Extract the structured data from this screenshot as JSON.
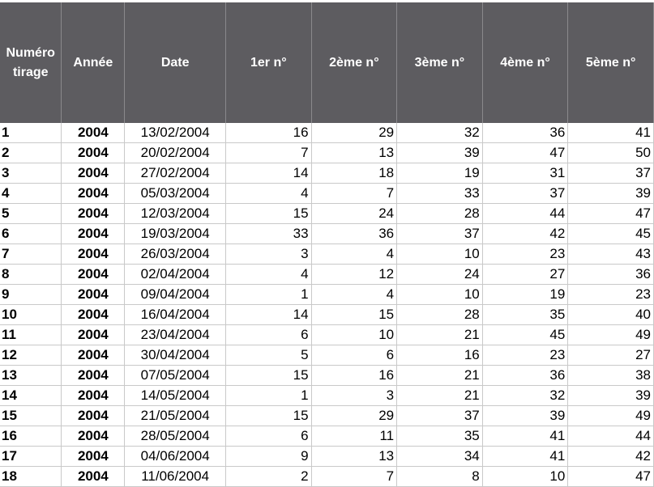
{
  "columns": [
    "Numéro tirage",
    "Année",
    "Date",
    "1er n°",
    "2ème n°",
    "3ème n°",
    "4ème n°",
    "5ème n°"
  ],
  "rows": [
    [
      "1",
      "2004",
      "13/02/2004",
      "16",
      "29",
      "32",
      "36",
      "41"
    ],
    [
      "2",
      "2004",
      "20/02/2004",
      "7",
      "13",
      "39",
      "47",
      "50"
    ],
    [
      "3",
      "2004",
      "27/02/2004",
      "14",
      "18",
      "19",
      "31",
      "37"
    ],
    [
      "4",
      "2004",
      "05/03/2004",
      "4",
      "7",
      "33",
      "37",
      "39"
    ],
    [
      "5",
      "2004",
      "12/03/2004",
      "15",
      "24",
      "28",
      "44",
      "47"
    ],
    [
      "6",
      "2004",
      "19/03/2004",
      "33",
      "36",
      "37",
      "42",
      "45"
    ],
    [
      "7",
      "2004",
      "26/03/2004",
      "3",
      "4",
      "10",
      "23",
      "43"
    ],
    [
      "8",
      "2004",
      "02/04/2004",
      "4",
      "12",
      "24",
      "27",
      "36"
    ],
    [
      "9",
      "2004",
      "09/04/2004",
      "1",
      "4",
      "10",
      "19",
      "23"
    ],
    [
      "10",
      "2004",
      "16/04/2004",
      "14",
      "15",
      "28",
      "35",
      "40"
    ],
    [
      "11",
      "2004",
      "23/04/2004",
      "6",
      "10",
      "21",
      "45",
      "49"
    ],
    [
      "12",
      "2004",
      "30/04/2004",
      "5",
      "6",
      "16",
      "23",
      "27"
    ],
    [
      "13",
      "2004",
      "07/05/2004",
      "15",
      "16",
      "21",
      "36",
      "38"
    ],
    [
      "14",
      "2004",
      "14/05/2004",
      "1",
      "3",
      "21",
      "32",
      "39"
    ],
    [
      "15",
      "2004",
      "21/05/2004",
      "15",
      "29",
      "37",
      "39",
      "49"
    ],
    [
      "16",
      "2004",
      "28/05/2004",
      "6",
      "11",
      "35",
      "41",
      "44"
    ],
    [
      "17",
      "2004",
      "04/06/2004",
      "9",
      "13",
      "34",
      "41",
      "42"
    ],
    [
      "18",
      "2004",
      "11/06/2004",
      "2",
      "7",
      "8",
      "10",
      "47"
    ]
  ],
  "colors": {
    "header_bg": "#5d5c60",
    "header_text": "#ffffff",
    "grid": "#c9c9c9"
  }
}
